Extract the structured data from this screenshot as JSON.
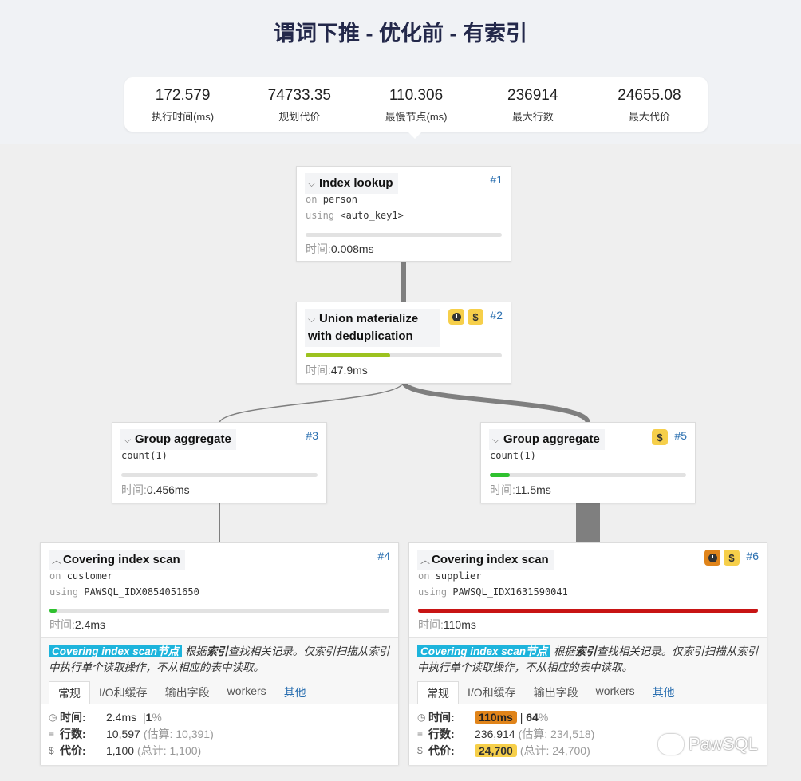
{
  "title": "谓词下推 - 优化前 - 有索引",
  "metrics": [
    {
      "value": "172.579",
      "label": "执行时间(ms)"
    },
    {
      "value": "74733.35",
      "label": "规划代价"
    },
    {
      "value": "110.306",
      "label": "最慢节点(ms)"
    },
    {
      "value": "236914",
      "label": "最大行数"
    },
    {
      "value": "24655.08",
      "label": "最大代价"
    }
  ],
  "nodes": {
    "n1": {
      "title": "Index lookup",
      "id": "#1",
      "on_kw": "on",
      "on_val": "person",
      "using_kw": "using",
      "using_val": "<auto_key1>",
      "time_k": "时间:",
      "time_v": "0.008ms",
      "progress": 0.0
    },
    "n2": {
      "title1": "Union materialize",
      "title2": "with deduplication",
      "id": "#2",
      "time_k": "时间:",
      "time_v": "47.9ms",
      "progress": 0.43,
      "bar_color": "#9cc21f"
    },
    "n3": {
      "title": "Group aggregate",
      "id": "#3",
      "detail": "count(1)",
      "time_k": "时间:",
      "time_v": "0.456ms",
      "progress": 0.0
    },
    "n5": {
      "title": "Group aggregate",
      "id": "#5",
      "detail": "count(1)",
      "time_k": "时间:",
      "time_v": "11.5ms",
      "progress": 0.1,
      "bar_color": "#2fc12f"
    },
    "n4": {
      "title": "Covering index scan",
      "id": "#4",
      "on_kw": "on",
      "on_val": "customer",
      "using_kw": "using",
      "using_val": "PAWSQL_IDX0854051650",
      "time_k": "时间:",
      "time_v": "2.4ms",
      "progress": 0.02,
      "bar_color": "#2fc12f",
      "desc_hl": "Covering index scan节点",
      "desc_a": "根据",
      "desc_b": "索引",
      "desc_c": "查找相关记录。仅索引扫描从索引中执行单个读取操作，不从相应的表中读取。",
      "tabs": [
        "常规",
        "I/O和缓存",
        "输出字段",
        "workers",
        "其他"
      ],
      "s_time_k": "时间:",
      "s_time_v": "2.4ms",
      "s_time_sep": "|",
      "s_pct": "1",
      "s_pct_u": "%",
      "s_rows_k": "行数:",
      "s_rows_v": "10,597",
      "s_rows_g": "(估算: 10,391)",
      "s_cost_k": "代价:",
      "s_cost_v": "1,100",
      "s_cost_g": "(总计: 1,100)"
    },
    "n6": {
      "title": "Covering index scan",
      "id": "#6",
      "on_kw": "on",
      "on_val": "supplier",
      "using_kw": "using",
      "using_val": "PAWSQL_IDX1631590041",
      "time_k": "时间:",
      "time_v": "110ms",
      "progress": 1.0,
      "bar_color": "#c81414",
      "desc_hl": "Covering index scan节点",
      "desc_a": "根据",
      "desc_b": "索引",
      "desc_c": "查找相关记录。仅索引扫描从索引中执行单个读取操作，不从相应的表中读取。",
      "tabs": [
        "常规",
        "I/O和缓存",
        "输出字段",
        "workers",
        "其他"
      ],
      "s_time_k": "时间:",
      "s_time_v": "110ms",
      "s_time_sep": "|",
      "s_pct": "64",
      "s_pct_u": "%",
      "s_rows_k": "行数:",
      "s_rows_v": "236,914",
      "s_rows_g": "(估算: 234,518)",
      "s_cost_k": "代价:",
      "s_cost_v": "24,700",
      "s_cost_g": "(总计: 24,700)"
    }
  },
  "icons": {
    "dollar": "$",
    "clock": "clock-icon"
  },
  "watermark": "PawSQL"
}
